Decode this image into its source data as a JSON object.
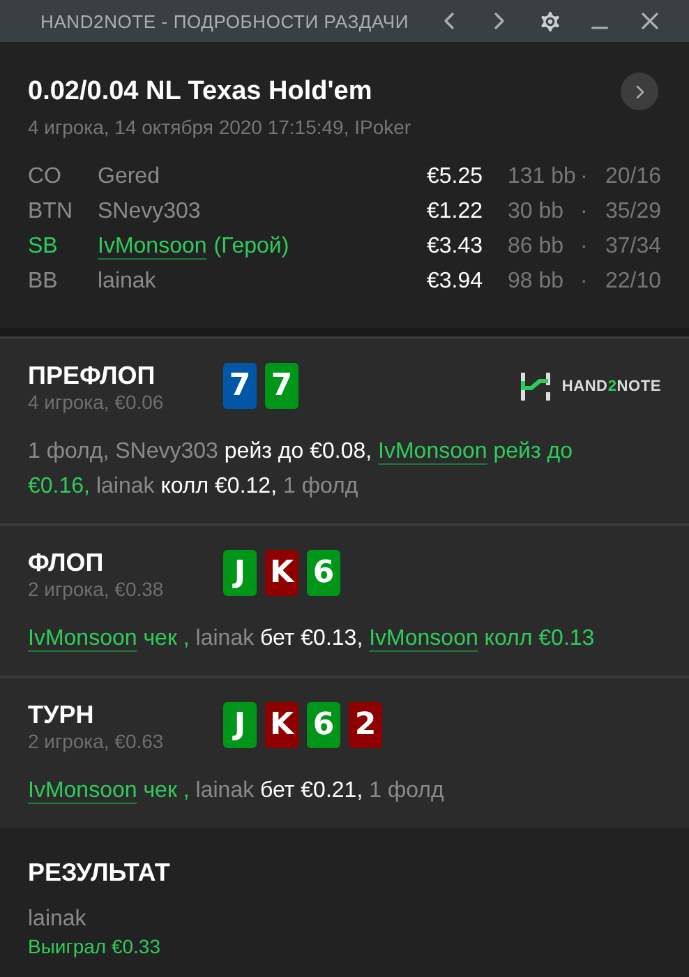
{
  "window": {
    "title": "HAND2NOTE - ПОДРОБНОСТИ РАЗДАЧИ"
  },
  "hand": {
    "title": "0.02/0.04 NL Texas Hold'em",
    "subtitle": "4 игрока, 14 октября 2020 17:15:49, IPoker",
    "players": [
      {
        "position": "CO",
        "name": "Gered",
        "hero": false,
        "stack": "€5.25",
        "bb": "131 bb",
        "dot": "·",
        "stats": "20/16"
      },
      {
        "position": "BTN",
        "name": "SNevy303",
        "hero": false,
        "stack": "€1.22",
        "bb": "30 bb",
        "dot": "·",
        "stats": "35/29"
      },
      {
        "position": "SB",
        "name": "IvMonsoon",
        "hero": true,
        "hero_label": "(Герой)",
        "stack": "€3.43",
        "bb": "86 bb",
        "dot": "·",
        "stats": "37/34"
      },
      {
        "position": "BB",
        "name": "lainak",
        "hero": false,
        "stack": "€3.94",
        "bb": "98 bb",
        "dot": "·",
        "stats": "22/10"
      }
    ]
  },
  "logo": {
    "text_before": "HAND",
    "accent": "2",
    "text_after": "NOTE"
  },
  "streets": [
    {
      "name": "ПРЕФЛОП",
      "info": "4 игрока, €0.06",
      "logo": true,
      "cards": [
        {
          "rank": "7",
          "color": "#0057a8"
        },
        {
          "rank": "7",
          "color": "#00961a"
        }
      ],
      "actions": [
        {
          "kind": "plain",
          "text": "1 фолд, "
        },
        {
          "kind": "plain",
          "text": "SNevy303 "
        },
        {
          "kind": "action",
          "text": "рейз до €0.08, "
        },
        {
          "kind": "hero",
          "text": "IvMonsoon"
        },
        {
          "kind": "hero-action",
          "text": " рейз до €0.16, "
        },
        {
          "kind": "plain",
          "text": "lainak "
        },
        {
          "kind": "action",
          "text": "колл €0.12, "
        },
        {
          "kind": "plain",
          "text": "1 фолд"
        }
      ]
    },
    {
      "name": "ФЛОП",
      "info": "2 игрока, €0.38",
      "logo": false,
      "cards": [
        {
          "rank": "J",
          "color": "#00961a"
        },
        {
          "rank": "K",
          "color": "#8e0000"
        },
        {
          "rank": "6",
          "color": "#00961a"
        }
      ],
      "actions": [
        {
          "kind": "hero",
          "text": "IvMonsoon"
        },
        {
          "kind": "hero-action",
          "text": " чек , "
        },
        {
          "kind": "plain",
          "text": "lainak "
        },
        {
          "kind": "action",
          "text": "бет €0.13, "
        },
        {
          "kind": "hero",
          "text": "IvMonsoon"
        },
        {
          "kind": "hero-action",
          "text": " колл €0.13"
        }
      ]
    },
    {
      "name": "ТУРН",
      "info": "2 игрока, €0.63",
      "logo": false,
      "cards": [
        {
          "rank": "J",
          "color": "#00961a"
        },
        {
          "rank": "K",
          "color": "#8e0000"
        },
        {
          "rank": "6",
          "color": "#00961a"
        },
        {
          "rank": "2",
          "color": "#8e0000"
        }
      ],
      "actions": [
        {
          "kind": "hero",
          "text": "IvMonsoon"
        },
        {
          "kind": "hero-action",
          "text": " чек , "
        },
        {
          "kind": "plain",
          "text": "lainak "
        },
        {
          "kind": "action",
          "text": "бет €0.21, "
        },
        {
          "kind": "plain",
          "text": "1 фолд"
        }
      ]
    }
  ],
  "result": {
    "title": "РЕЗУЛЬТАТ",
    "winner": "lainak",
    "outcome": "Выиграл €0.33"
  }
}
